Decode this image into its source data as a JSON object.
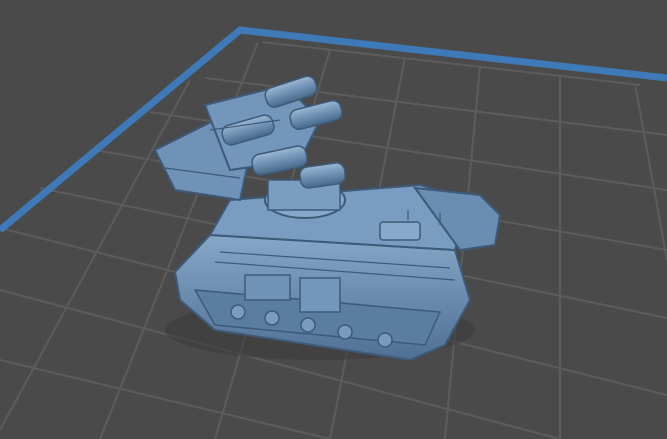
{
  "app": {
    "view": "3d-print-slicer-build-plate",
    "background_color": "#4a4a4a",
    "grid_color": "#5e5e5e",
    "bed_border_color": "#3e7ab8",
    "model_color": "#6b8fb4"
  },
  "model": {
    "name": "",
    "icon": "tank-model-icon"
  }
}
